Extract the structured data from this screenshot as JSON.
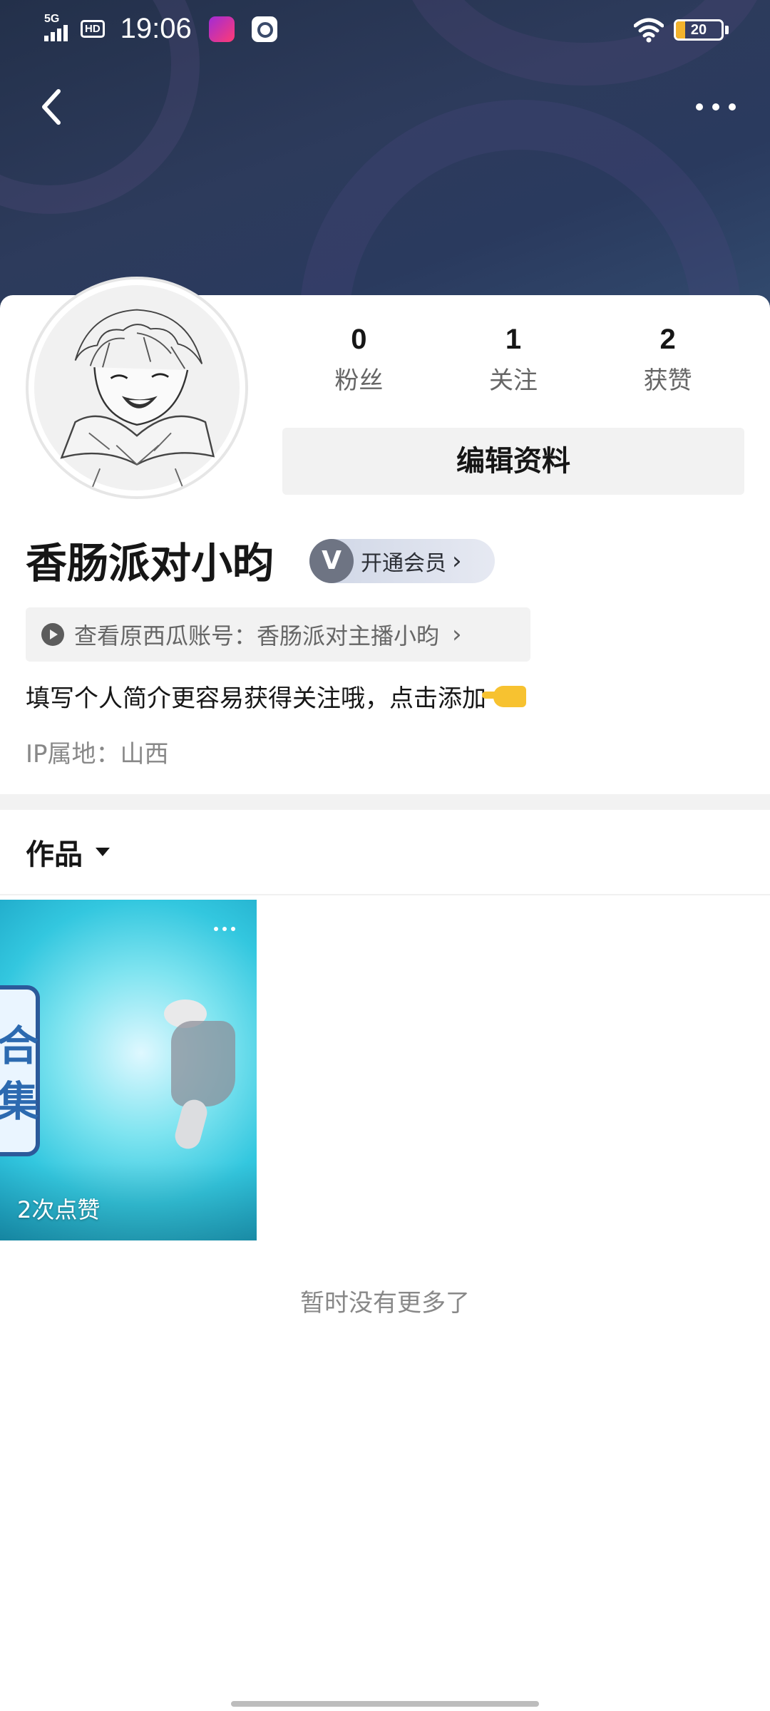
{
  "status_bar": {
    "network": "5G",
    "hd_label": "HD",
    "time": "19:06",
    "battery": "20"
  },
  "header": {
    "back_icon": "chevron-left-icon",
    "more_icon": "more-horizontal-icon"
  },
  "profile": {
    "stats": [
      {
        "num": "0",
        "label": "粉丝"
      },
      {
        "num": "1",
        "label": "关注"
      },
      {
        "num": "2",
        "label": "获赞"
      }
    ],
    "edit_label": "编辑资料",
    "username": "香肠派对小昀",
    "vip": {
      "mark": "V",
      "label": "开通会员"
    },
    "xigua_link": "查看原西瓜账号：香肠派对主播小昀",
    "bio": "填写个人简介更容易获得关注哦，点击添加",
    "ip": "IP属地：山西"
  },
  "tabs": {
    "works_label": "作品"
  },
  "videos": [
    {
      "likes": "2次点赞",
      "overlay_text": "合集"
    }
  ],
  "footer": {
    "no_more": "暂时没有更多了"
  },
  "colors": {
    "banner": "#2d3b5c",
    "battery_fill": "#f3b32c",
    "vip_badge": "#cfd6e6"
  }
}
